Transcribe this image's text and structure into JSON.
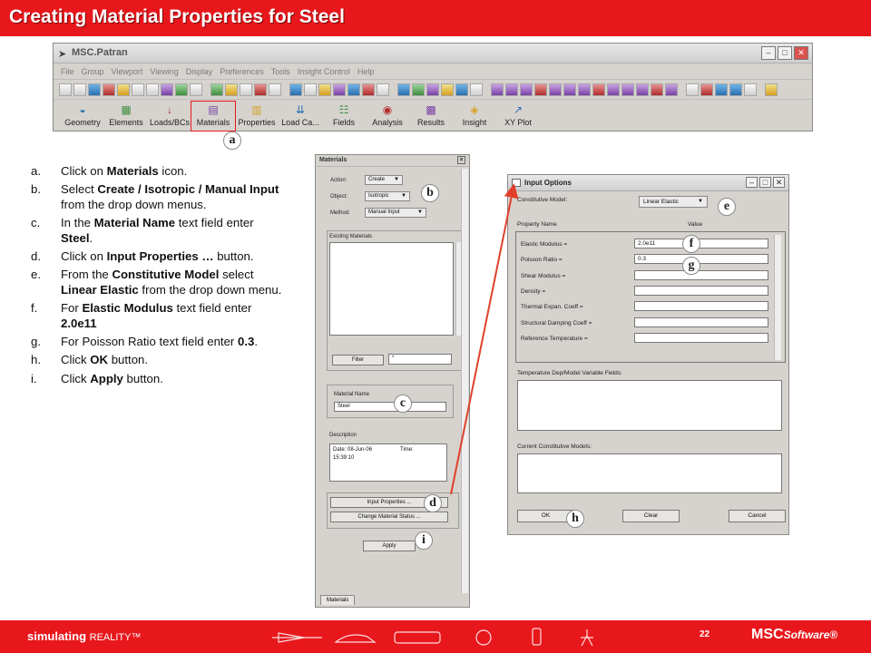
{
  "slide": {
    "title": "Creating Material Properties for Steel",
    "page_number": "22",
    "footer_brand_bold": "simulating",
    "footer_brand_light": "REALITY™",
    "footer_logo": "MSC",
    "footer_logo_suffix": "Software®"
  },
  "patran": {
    "window_title": "MSC.Patran",
    "menu": [
      "File",
      "Group",
      "Viewport",
      "Viewing",
      "Display",
      "Preferences",
      "Tools",
      "Insight Control",
      "Help"
    ],
    "apps": [
      {
        "label": "Geometry",
        "icon": "geometry-icon"
      },
      {
        "label": "Elements",
        "icon": "elements-icon"
      },
      {
        "label": "Loads/BCs",
        "icon": "loads-icon"
      },
      {
        "label": "Materials",
        "icon": "materials-icon"
      },
      {
        "label": "Properties",
        "icon": "properties-icon"
      },
      {
        "label": "Load Ca...",
        "icon": "load-cases-icon"
      },
      {
        "label": "Fields",
        "icon": "fields-icon"
      },
      {
        "label": "Analysis",
        "icon": "analysis-icon"
      },
      {
        "label": "Results",
        "icon": "results-icon"
      },
      {
        "label": "Insight",
        "icon": "insight-icon"
      },
      {
        "label": "XY Plot",
        "icon": "xy-plot-icon"
      }
    ]
  },
  "markers": {
    "a": "a",
    "b": "b",
    "c": "c",
    "d": "d",
    "e": "e",
    "f": "f",
    "g": "g",
    "h": "h",
    "i": "i"
  },
  "instructions": [
    {
      "letter": "a.",
      "parts": [
        {
          "t": "Click on  "
        },
        {
          "b": "Materials"
        },
        {
          "t": " icon."
        }
      ]
    },
    {
      "letter": "b.",
      "parts": [
        {
          "t": "Select "
        },
        {
          "b": "Create / Isotropic / Manual Input"
        },
        {
          "t": " from the drop down menus."
        }
      ]
    },
    {
      "letter": "c.",
      "parts": [
        {
          "t": "In the "
        },
        {
          "b": "Material Name"
        },
        {
          "t": " text field enter "
        },
        {
          "b": "Steel"
        },
        {
          "t": "."
        }
      ]
    },
    {
      "letter": "d.",
      "parts": [
        {
          "t": "Click on "
        },
        {
          "b": "Input Properties …"
        },
        {
          "t": " button."
        }
      ]
    },
    {
      "letter": "e.",
      "parts": [
        {
          "t": "From the "
        },
        {
          "b": "Constitutive Model"
        },
        {
          "t": " select "
        },
        {
          "b": "Linear Elastic"
        },
        {
          "t": " from the drop down menu."
        }
      ]
    },
    {
      "letter": "f.",
      "parts": [
        {
          "t": "For "
        },
        {
          "b": "Elastic Modulus"
        },
        {
          "t": " text field enter "
        },
        {
          "b": "2.0e11"
        }
      ]
    },
    {
      "letter": "g.",
      "parts": [
        {
          "t": "For Poisson Ratio text field enter "
        },
        {
          "b": "0.3"
        },
        {
          "t": "."
        }
      ]
    },
    {
      "letter": "h.",
      "parts": [
        {
          "t": "Click "
        },
        {
          "b": "OK"
        },
        {
          "t": " button."
        }
      ]
    },
    {
      "letter": "i.",
      "parts": [
        {
          "t": "Click "
        },
        {
          "b": "Apply"
        },
        {
          "t": " button."
        }
      ]
    }
  ],
  "materials_form": {
    "title": "Materials",
    "action_label": "Action:",
    "action_value": "Create",
    "object_label": "Object:",
    "object_value": "Isotropic",
    "method_label": "Method:",
    "method_value": "Manual Input",
    "existing_label": "Existing Materials",
    "filter_button": "Filter",
    "filter_value": "*",
    "material_name_label": "Material Name",
    "material_name_value": "Steel",
    "description_label": "Description",
    "description_line1": "Date: 08-Jun-06",
    "description_time_label": "Time:",
    "description_line2": "15:39:10",
    "input_properties_button": "Input Properties ...",
    "change_status_button": "Change Material Status ...",
    "apply_button": "Apply",
    "tab_label": "Materials"
  },
  "input_options": {
    "title": "Input Options",
    "constitutive_label": "Constitutive Model:",
    "constitutive_value": "Linear Elastic",
    "col_property": "Property Name",
    "col_value": "Value",
    "properties": [
      {
        "name": "Elastic Modulus =",
        "value": "2.0e11"
      },
      {
        "name": "Poisson Ratio =",
        "value": "0.3"
      },
      {
        "name": "Shear Modulus =",
        "value": ""
      },
      {
        "name": "Density =",
        "value": ""
      },
      {
        "name": "Thermal Expan. Coeff =",
        "value": ""
      },
      {
        "name": "Structural Damping Coeff =",
        "value": ""
      },
      {
        "name": "Reference Temperature =",
        "value": ""
      }
    ],
    "temp_fields_label": "Temperature Dep/Model Variable Fields:",
    "current_models_label": "Current Constitutive Models:",
    "ok_button": "OK",
    "clear_button": "Clear",
    "cancel_button": "Cancel"
  },
  "colors": {
    "accent": "#e8171c",
    "window_bg": "#d6d3ce"
  }
}
